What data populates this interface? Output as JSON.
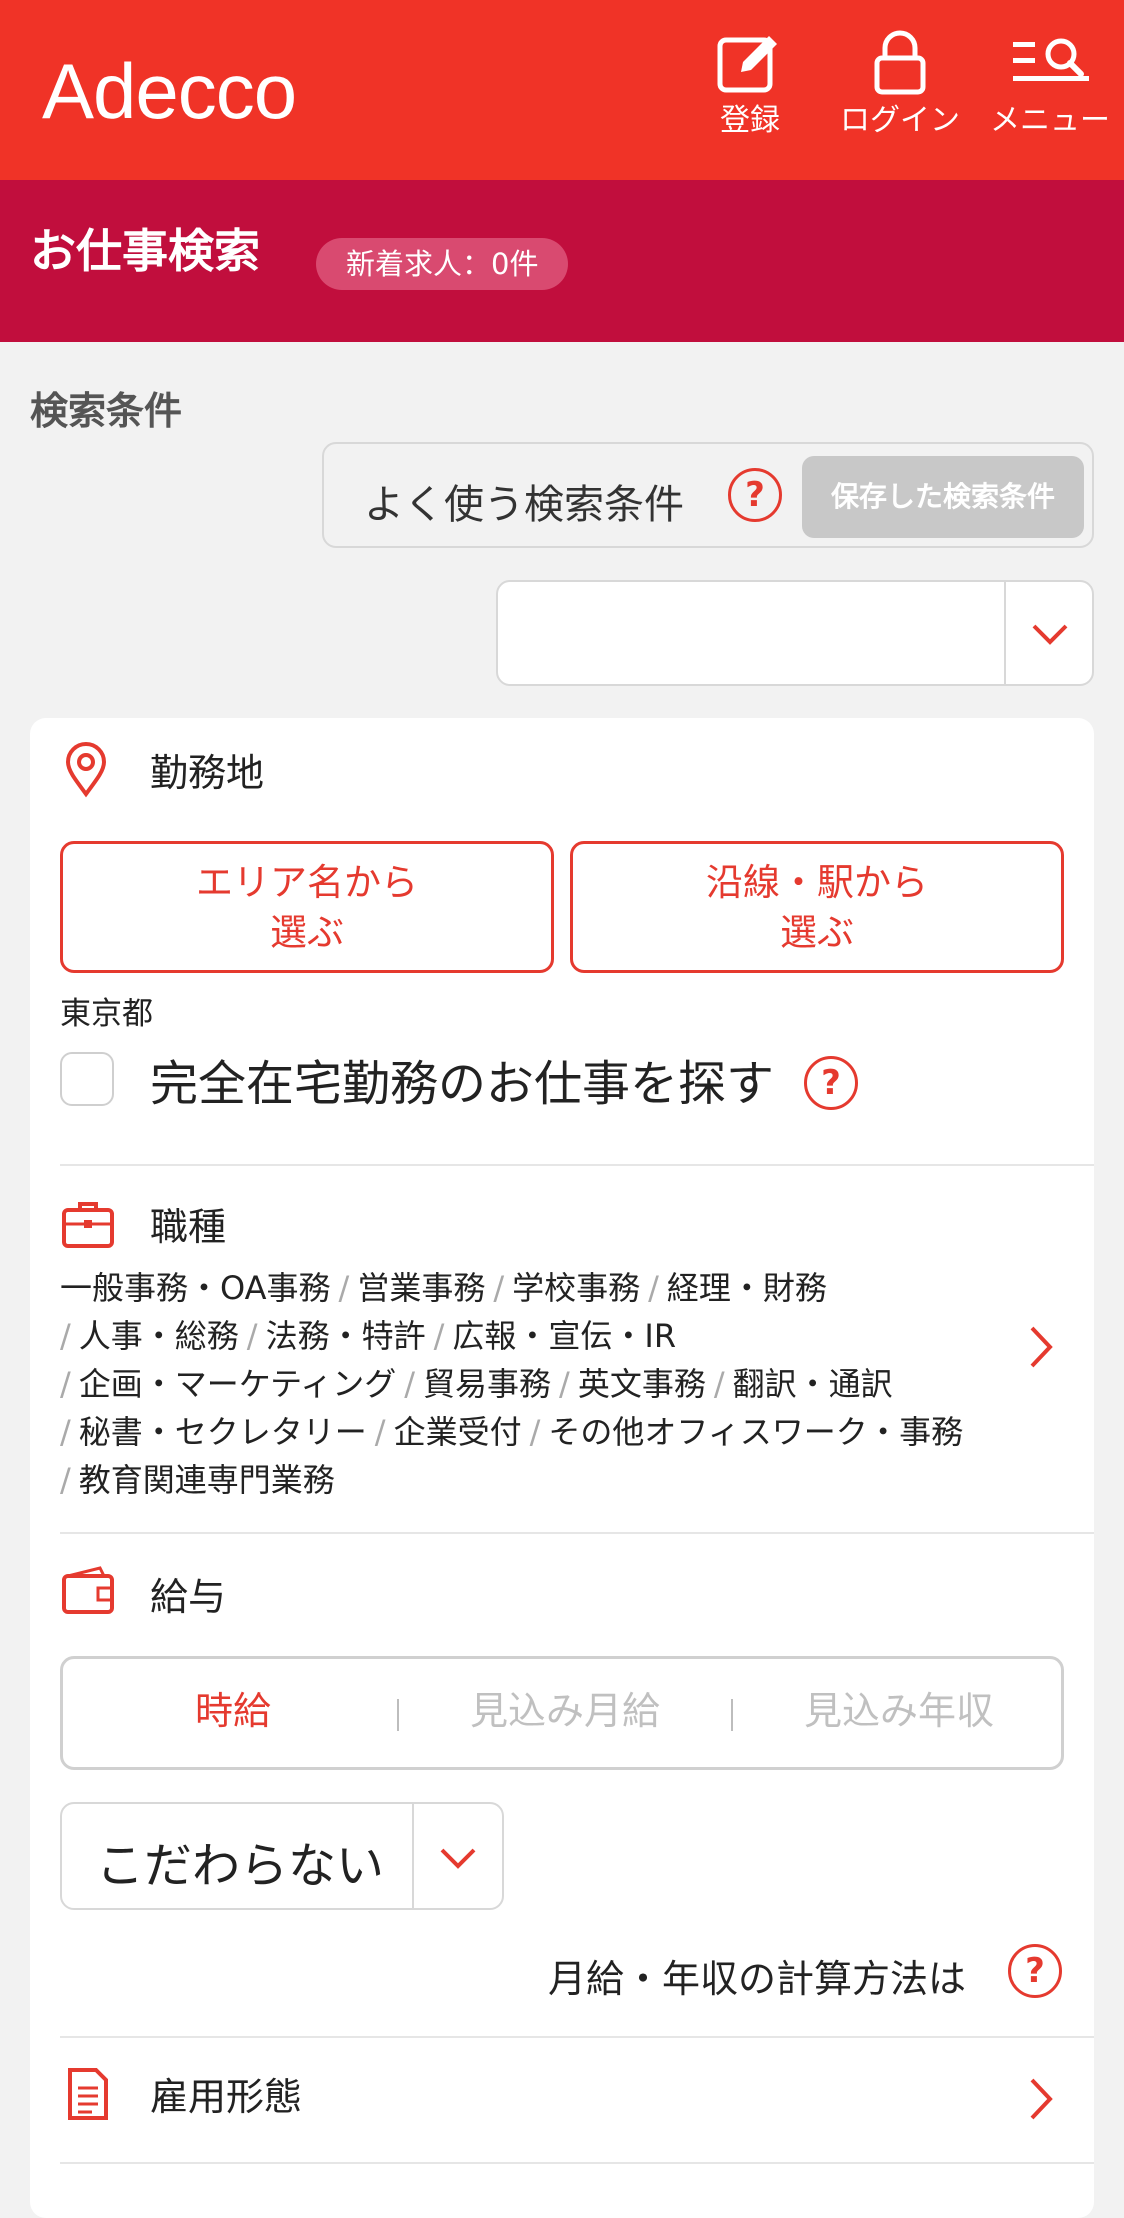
{
  "header": {
    "logo": "Adecco",
    "register_label": "登録",
    "login_label": "ログイン",
    "menu_label": "メニュー"
  },
  "title_band": {
    "title": "お仕事検索",
    "new_jobs": "新着求人：0件"
  },
  "search": {
    "heading": "検索条件",
    "saved_conditions_label": "よく使う検索条件",
    "saved_conditions_button": "保存した検索条件",
    "help_glyph": "?"
  },
  "location": {
    "label": "勤務地",
    "area_button_line1": "エリア名から",
    "area_button_line2": "選ぶ",
    "line_button_line1": "沿線・駅から",
    "line_button_line2": "選ぶ",
    "selected": "東京都",
    "remote_label": "完全在宅勤務のお仕事を探す"
  },
  "job_type": {
    "label": "職種",
    "items": [
      "一般事務・OA事務",
      "営業事務",
      "学校事務",
      "経理・財務",
      "人事・総務",
      "法務・特許",
      "広報・宣伝・IR",
      "企画・マーケティング",
      "貿易事務",
      "英文事務",
      "翻訳・通訳",
      "秘書・セクレタリー",
      "企業受付",
      "その他オフィスワーク・事務",
      "教育関連専門業務"
    ],
    "separator": "/"
  },
  "salary": {
    "label": "給与",
    "tabs": [
      "時給",
      "見込み月給",
      "見込み年収"
    ],
    "tab_separator": "|",
    "select_value": "こだわらない",
    "calc_method_label": "月給・年収の計算方法は"
  },
  "employment": {
    "label": "雇用形態"
  },
  "colors": {
    "header_red": "#f03327",
    "band_crimson": "#c10e3d",
    "accent_red": "#e53a2f"
  },
  "icons": [
    "edit-icon",
    "lock-icon",
    "menu-search-icon",
    "help-icon",
    "chevron-down-icon",
    "location-pin-icon",
    "briefcase-icon",
    "wallet-icon",
    "document-icon",
    "chevron-right-icon"
  ]
}
